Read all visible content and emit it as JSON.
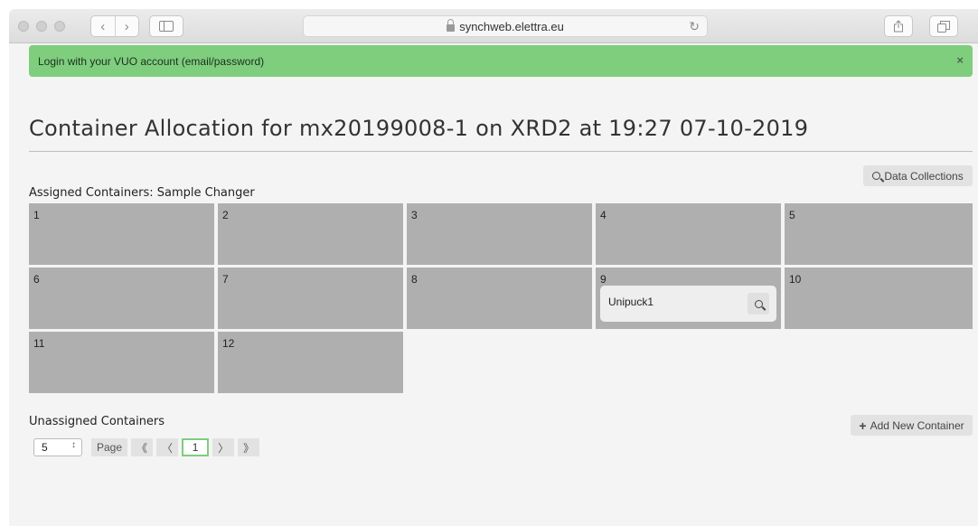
{
  "browser": {
    "url": "synchweb.elettra.eu"
  },
  "alert": {
    "message": "Login with your VUO account (email/password)",
    "close": "×"
  },
  "page": {
    "title": "Container Allocation for mx20199008-1 on XRD2 at 19:27 07-10-2019",
    "data_collections_label": "Data Collections",
    "assigned_label": "Assigned Containers: Sample Changer",
    "unassigned_label": "Unassigned Containers",
    "add_container_label": "Add New Container"
  },
  "positions": [
    {
      "num": "1",
      "container": null
    },
    {
      "num": "2",
      "container": null
    },
    {
      "num": "3",
      "container": null
    },
    {
      "num": "4",
      "container": null
    },
    {
      "num": "5",
      "container": null
    },
    {
      "num": "6",
      "container": null
    },
    {
      "num": "7",
      "container": null
    },
    {
      "num": "8",
      "container": null
    },
    {
      "num": "9",
      "container": "Unipuck1"
    },
    {
      "num": "10",
      "container": null
    },
    {
      "num": "11",
      "container": null
    },
    {
      "num": "12",
      "container": null
    }
  ],
  "pagination": {
    "per_page": "5",
    "page_label": "Page",
    "first": "《",
    "prev": "〈",
    "current": "1",
    "next": "〉",
    "last": "》"
  },
  "colors": {
    "alert": "#7ece7e",
    "cell": "#afafaf",
    "active_page_border": "#7ece7e"
  },
  "icons": [
    "lock-icon",
    "reload-icon",
    "share-icon",
    "tabs-icon",
    "sidebar-icon",
    "search-icon",
    "plus-icon",
    "close-icon"
  ]
}
